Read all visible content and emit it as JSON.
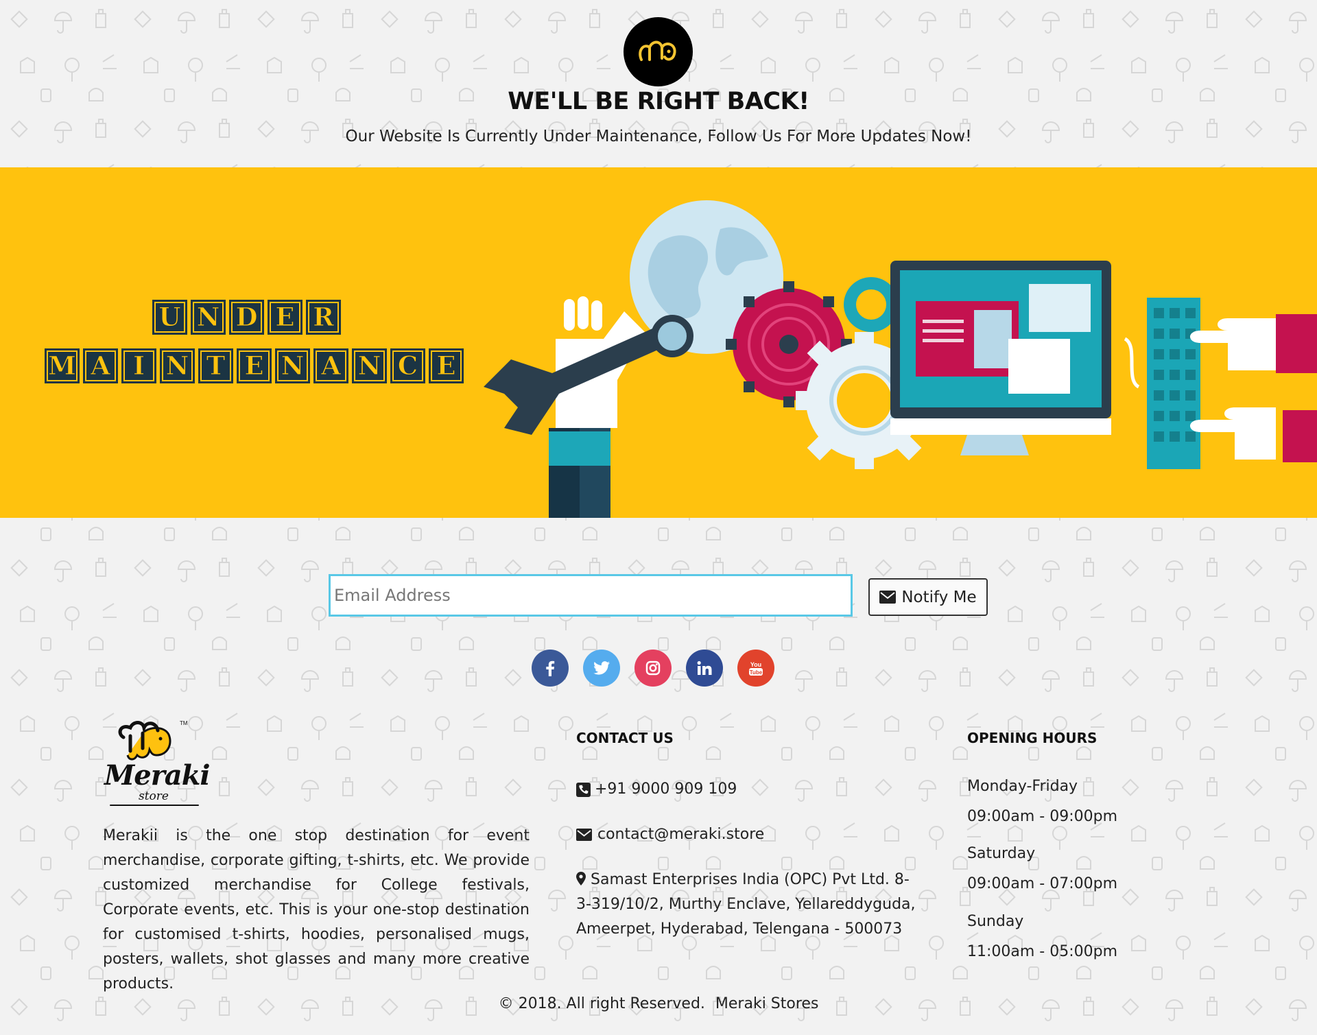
{
  "header": {
    "headline": "WE'LL BE RIGHT BACK!",
    "subline": "Our Website Is Currently Under Maintenance, Follow Us For More Updates Now!"
  },
  "banner": {
    "line1": [
      "U",
      "N",
      "D",
      "E",
      "R"
    ],
    "line2": [
      "M",
      "A",
      "I",
      "N",
      "T",
      "E",
      "N",
      "A",
      "N",
      "C",
      "E"
    ],
    "background": "#ffc20e"
  },
  "form": {
    "email_placeholder": "Email Address",
    "email_value": "",
    "notify_label": "Notify Me"
  },
  "social": [
    {
      "name": "facebook",
      "color": "#3b5998"
    },
    {
      "name": "twitter",
      "color": "#55acee"
    },
    {
      "name": "instagram",
      "color": "#e4405f"
    },
    {
      "name": "linkedin",
      "color": "#2f4b94"
    },
    {
      "name": "youtube",
      "color": "#e1432c"
    }
  ],
  "footer": {
    "brand_name": "Meraki",
    "brand_sub": "store",
    "about": "Merakii is the one stop destination for event merchandise, corporate gifting, t-shirts, etc. We provide customized merchandise for College festivals, Corporate events, etc. This is your one-stop destination for customised t-shirts, hoodies, personalised mugs, posters, wallets, shot glasses and many more creative products.",
    "contact_heading": "CONTACT US",
    "phone": "+91 9000 909 109",
    "email": "contact@meraki.store",
    "address": "Samast Enterprises India (OPC) Pvt Ltd. 8-3-319/10/2, Murthy Enclave, Yellareddyguda, Ameerpet, Hyderabad, Telengana - 500073",
    "hours_heading": "OPENING HOURS",
    "hours": [
      {
        "day": "Monday-Friday",
        "time": "09:00am - 09:00pm"
      },
      {
        "day": "Saturday",
        "time": "09:00am - 07:00pm"
      },
      {
        "day": "Sunday",
        "time": "11:00am - 05:00pm"
      }
    ],
    "copyright": "© 2018. All right Reserved.",
    "copyright_brand": "Meraki Stores"
  }
}
